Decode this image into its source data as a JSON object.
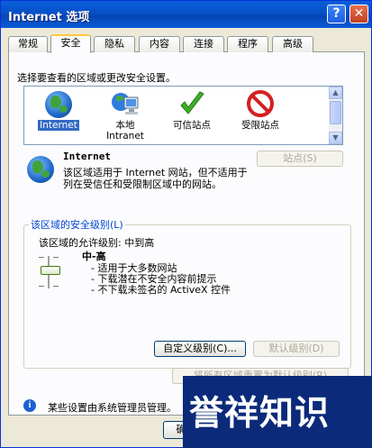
{
  "window": {
    "title": "Internet 选项",
    "help_glyph": "?",
    "close_glyph": "✕"
  },
  "tabs": [
    "常规",
    "安全",
    "隐私",
    "内容",
    "连接",
    "程序",
    "高级"
  ],
  "active_tab": "安全",
  "instruction": "选择要查看的区域或更改安全设置。",
  "zones": [
    {
      "label": "Internet",
      "icon": "globe-icon",
      "selected": true
    },
    {
      "label": "本地 Intranet",
      "icon": "intranet-icon",
      "selected": false
    },
    {
      "label": "可信站点",
      "icon": "checkmark-icon",
      "selected": false
    },
    {
      "label": "受限站点",
      "icon": "restricted-icon",
      "selected": false
    }
  ],
  "zone_detail": {
    "name": "Internet",
    "description": "该区域适用于 Internet 网站，但不适用于列在受信任和受限制区域中的网站。",
    "sites_button": "站点(S)"
  },
  "security_level": {
    "legend": "该区域的安全级别(L)",
    "allowed_levels": "该区域的允许级别: 中到高",
    "level_name": "中-高",
    "bullets": [
      "- 适用于大多数网站",
      "- 下载潜在不安全内容前提示",
      "- 不下载未签名的 ActiveX 控件"
    ],
    "custom_button": "自定义级别(C)...",
    "default_button": "默认级别(D)",
    "reset_all_button": "将所有区域重置为默认级别(R)"
  },
  "admin_note": "某些设置由系统管理员管理。",
  "ok_button": "确",
  "watermark": "誉祥知识",
  "colors": {
    "accent": "#316ac5",
    "title_bar": "#0750c8",
    "legend": "#0046d5"
  }
}
